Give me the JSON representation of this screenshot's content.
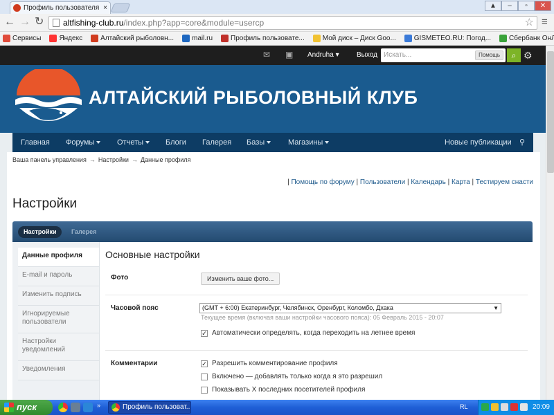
{
  "browser": {
    "tab_title": "Профиль пользователя - А",
    "url_host": "altfishing-club.ru",
    "url_path": "/index.php?app=core&module=usercp",
    "bookmarks": [
      {
        "label": "Сервисы",
        "color": "#e04b3a"
      },
      {
        "label": "Яндекс",
        "color": "#ff3333"
      },
      {
        "label": "Алтайский рыболовн...",
        "color": "#d03b1e"
      },
      {
        "label": "mail.ru",
        "color": "#1d67c0"
      },
      {
        "label": "Профиль пользовате...",
        "color": "#c0302a"
      },
      {
        "label": "Мой диск – Диск Goo...",
        "color": "#f1c232"
      },
      {
        "label": "GISMETEO.RU: Погод...",
        "color": "#3a7ad8"
      },
      {
        "label": "Сбербанк ОнЛ@йн",
        "color": "#3aa33a"
      }
    ]
  },
  "userbar": {
    "username": "Andruha",
    "logout": "Выход",
    "search_placeholder": "Искать...",
    "search_help": "Помощь"
  },
  "header": {
    "title": "АЛТАЙСКИЙ РЫБОЛОВНЫЙ КЛУБ"
  },
  "nav": {
    "items": [
      "Главная",
      "Форумы",
      "Отчеты",
      "Блоги",
      "Галерея",
      "Базы",
      "Магазины"
    ],
    "right": "Новые публикации"
  },
  "breadcrumb": [
    "Ваша панель управления",
    "Настройки",
    "Данные профиля"
  ],
  "toplinks": [
    "Помощь по форуму",
    "Пользователи",
    "Календарь",
    "Карта",
    "Тестируем снасти"
  ],
  "page_title": "Настройки",
  "tabs": [
    "Настройки",
    "Галерея"
  ],
  "sidemenu": [
    "Данные профиля",
    "E-mail и пароль",
    "Изменить подпись",
    "Игнорируемые пользователи",
    "Настройки уведомлений",
    "Уведомления"
  ],
  "settings": {
    "section_title": "Основные настройки",
    "photo_label": "Фото",
    "photo_button": "Изменить ваше фото...",
    "tz_label": "Часовой пояс",
    "tz_value": "(GMT + 6:00) Екатеринбург, Челябинск, Оренбург, Коломбо, Дхака",
    "tz_hint": "Текущее время (включая ваши настройки часового пояса): 05 Февраль 2015 - 20:07",
    "dst_label": "Автоматически определять, когда переходить на летнее время",
    "dst_checked": true,
    "comments_label": "Комментарии",
    "comment_options": [
      {
        "label": "Разрешить комментирование профиля",
        "checked": true
      },
      {
        "label": "Включено — добавлять только когда я это разрешил",
        "checked": false
      },
      {
        "label": "Показывать X последних посетителей профиля",
        "checked": false
      }
    ]
  },
  "taskbar": {
    "start": "пуск",
    "task": "Профиль пользоват...",
    "lang": "RL",
    "clock": "20:09"
  }
}
